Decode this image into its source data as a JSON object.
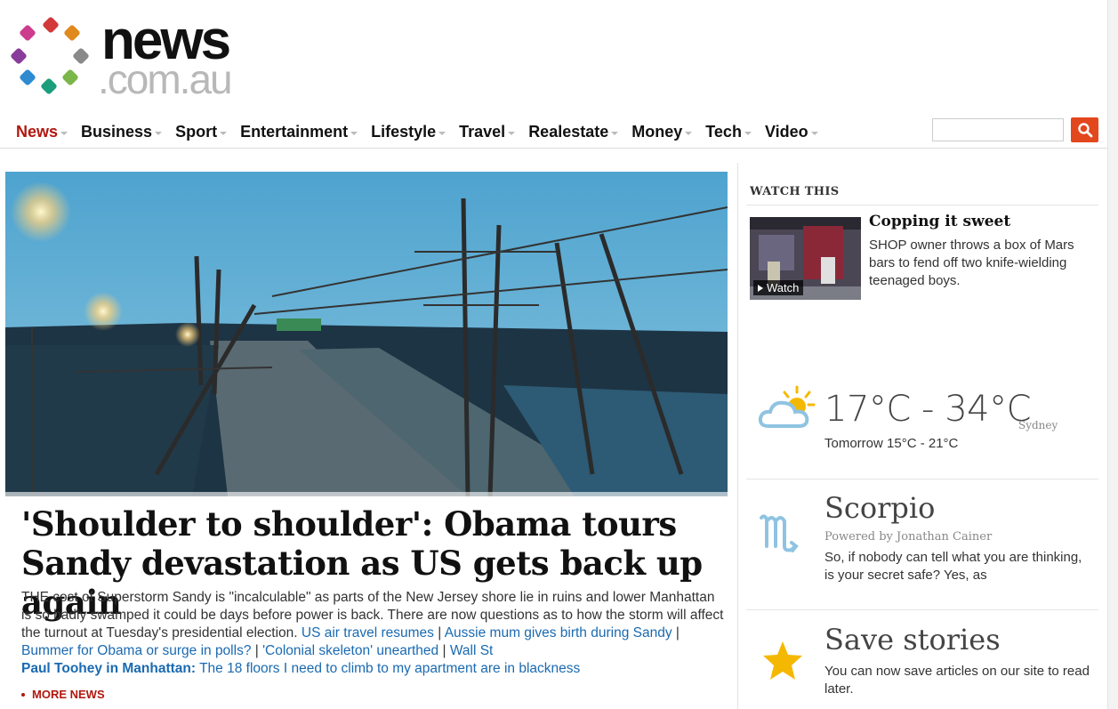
{
  "site": {
    "logo_word": "news",
    "logo_domain": ".com.au"
  },
  "nav": {
    "items": [
      {
        "label": "News",
        "active": true
      },
      {
        "label": "Business"
      },
      {
        "label": "Sport"
      },
      {
        "label": "Entertainment"
      },
      {
        "label": "Lifestyle"
      },
      {
        "label": "Travel"
      },
      {
        "label": "Realestate"
      },
      {
        "label": "Money"
      },
      {
        "label": "Tech"
      },
      {
        "label": "Video"
      }
    ],
    "search_placeholder": ""
  },
  "hero": {
    "headline": "'Shoulder to shoulder': Obama tours Sandy devastation as US gets back up again",
    "summary": "THE cost of Superstorm Sandy is \"incalculable\" as parts of the New Jersey shore lie in ruins and lower Manhattan is so badly swamped it could be days before power is back. There are now questions as to how the storm will affect the turnout at Tuesday's presidential election.",
    "links": [
      "US air travel resumes",
      "Aussie mum gives birth during Sandy",
      "Bummer for Obama or surge in polls?",
      "'Colonial skeleton' unearthed",
      "Wall St"
    ],
    "byline": "Paul Toohey in Manhattan:",
    "byline_link": "The 18 floors I need to climb to my apartment are in blackness",
    "more_news": "MORE NEWS"
  },
  "watch": {
    "section_title": "WATCH THIS",
    "badge": "Watch",
    "headline": "Copping it sweet",
    "desc": "SHOP owner throws a box of Mars bars to fend off two knife-wielding teenaged boys."
  },
  "weather": {
    "range": "17°C - 34°C",
    "city": "Sydney",
    "tomorrow": "Tomorrow 15°C - 21°C",
    "icon": "partly-sunny-icon"
  },
  "horoscope": {
    "sign": "Scorpio",
    "powered": "Powered by Jonathan Cainer",
    "desc": "So, if nobody can tell what you are thinking, is your secret safe? Yes, as",
    "icon": "scorpio-icon"
  },
  "save": {
    "title": "Save stories",
    "desc": "You can now save articles on our site to read later.",
    "icon": "star-icon"
  },
  "colors": {
    "brand_red": "#b1170f",
    "link_blue": "#1a6ab1",
    "search_orange": "#e3471d",
    "star_yellow": "#f5b800",
    "icon_blue": "#8fc3e2"
  }
}
